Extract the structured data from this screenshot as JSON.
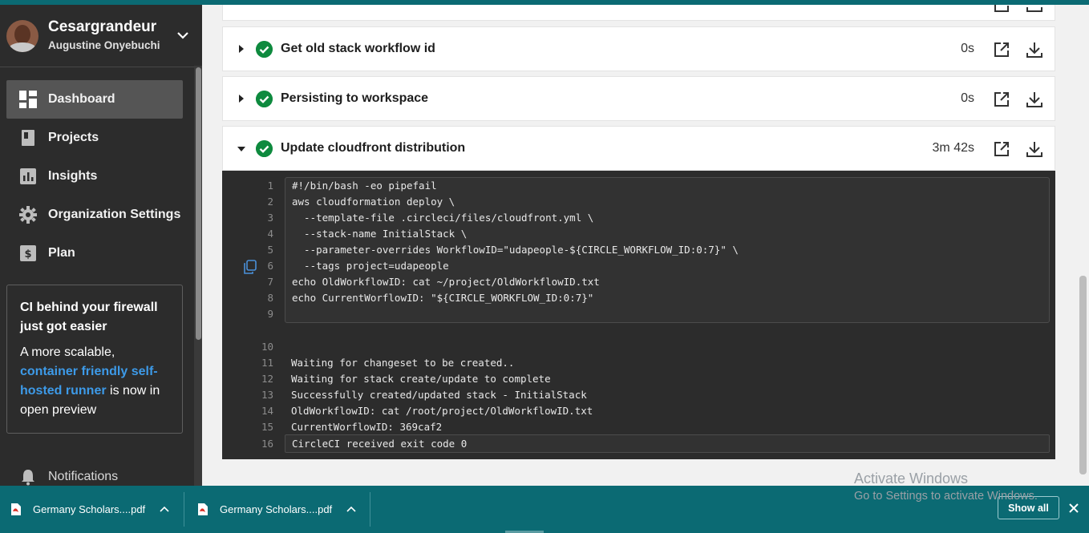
{
  "sidebar": {
    "org_name": "Cesargrandeur",
    "user_name": "Augustine Onyebuchi",
    "nav": [
      {
        "label": "Dashboard",
        "icon": "dashboard-icon"
      },
      {
        "label": "Projects",
        "icon": "projects-icon"
      },
      {
        "label": "Insights",
        "icon": "insights-icon"
      },
      {
        "label": "Organization Settings",
        "icon": "gear-icon"
      },
      {
        "label": "Plan",
        "icon": "dollar-icon"
      }
    ],
    "promo": {
      "title": "CI behind your firewall just got easier",
      "body_start": "A more scalable, ",
      "link": "container friendly self-hosted runner",
      "body_end": " is now in open preview"
    },
    "notifications_label": "Notifications"
  },
  "steps": [
    {
      "title": "Get old stack workflow id",
      "duration": "0s",
      "expanded": false
    },
    {
      "title": "Persisting to workspace",
      "duration": "0s",
      "expanded": false
    },
    {
      "title": "Update cloudfront distribution",
      "duration": "3m 42s",
      "expanded": true
    }
  ],
  "terminal": {
    "command_lines": [
      {
        "n": "1",
        "text": "#!/bin/bash -eo pipefail"
      },
      {
        "n": "2",
        "text": "aws cloudformation deploy \\"
      },
      {
        "n": "3",
        "text": "  --template-file .circleci/files/cloudfront.yml \\"
      },
      {
        "n": "4",
        "text": "  --stack-name InitialStack \\"
      },
      {
        "n": "5",
        "text": "  --parameter-overrides WorkflowID=\"udapeople-${CIRCLE_WORKFLOW_ID:0:7}\" \\"
      },
      {
        "n": "6",
        "text": "  --tags project=udapeople"
      },
      {
        "n": "7",
        "text": "echo OldWorkflowID: cat ~/project/OldWorkflowID.txt"
      },
      {
        "n": "8",
        "text": "echo CurrentWorflowID: \"${CIRCLE_WORKFLOW_ID:0:7}\""
      },
      {
        "n": "9",
        "text": ""
      }
    ],
    "output_lines": [
      {
        "n": "10",
        "text": ""
      },
      {
        "n": "11",
        "text": "Waiting for changeset to be created.."
      },
      {
        "n": "12",
        "text": "Waiting for stack create/update to complete"
      },
      {
        "n": "13",
        "text": "Successfully created/updated stack - InitialStack"
      },
      {
        "n": "14",
        "text": "OldWorkflowID: cat /root/project/OldWorkflowID.txt"
      },
      {
        "n": "15",
        "text": "CurrentWorflowID: 369caf2"
      }
    ],
    "exit_line": {
      "n": "16",
      "text": "CircleCI received exit code 0"
    }
  },
  "watermark": {
    "line1": "Activate Windows",
    "line2": "Go to Settings to activate Windows."
  },
  "downloads": {
    "items": [
      {
        "name": "Germany Scholars....pdf"
      },
      {
        "name": "Germany Scholars....pdf"
      }
    ],
    "show_all": "Show all"
  },
  "colors": {
    "success": "#0e8a3e",
    "link": "#3d9ae8",
    "download_bar": "#0b6a73"
  }
}
